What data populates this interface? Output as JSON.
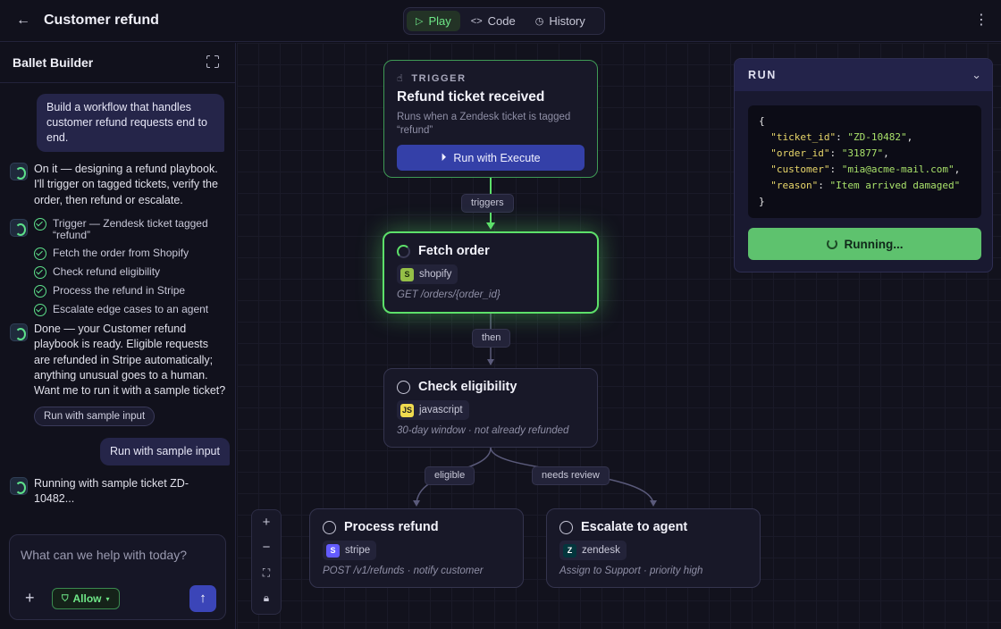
{
  "header": {
    "title": "Customer refund",
    "tabs": [
      {
        "label": "Play",
        "icon": "play-icon"
      },
      {
        "label": "Code",
        "icon": "code-icon"
      },
      {
        "label": "History",
        "icon": "history-icon"
      }
    ],
    "active_tab": "Play"
  },
  "sidebar": {
    "title": "Ballet Builder",
    "messages": {
      "user_1": "Build a workflow that handles customer refund requests end to end.",
      "assistant_1": "On it — designing a refund playbook. I'll trigger on tagged tickets, verify the order, then refund or escalate.",
      "steps": [
        "Trigger — Zendesk ticket tagged “refund”",
        "Fetch the order from Shopify",
        "Check refund eligibility",
        "Process the refund in Stripe",
        "Escalate edge cases to an agent"
      ],
      "assistant_2": "Done — your Customer refund playbook is ready. Eligible requests are refunded in Stripe automatically; anything unusual goes to a human. Want me to run it with a sample ticket?",
      "suggestion_chip": "Run with sample input",
      "user_2": "Run with sample input",
      "assistant_3": "Running with sample ticket ZD-10482..."
    },
    "composer": {
      "placeholder": "What can we help with today?",
      "allow_label": "Allow"
    }
  },
  "canvas": {
    "trigger": {
      "kicker": "TRIGGER",
      "title": "Refund ticket received",
      "subtitle": "Runs when a Zendesk ticket is tagged “refund”",
      "button": "Run with Execute"
    },
    "nodes": {
      "fetch": {
        "title": "Fetch order",
        "tag": "shopify",
        "detail": "GET /orders/{order_id}",
        "status": "running"
      },
      "check": {
        "title": "Check eligibility",
        "tag": "javascript",
        "tag_logo": "JS",
        "detail": "30-day window · not already refunded",
        "status": "pending"
      },
      "process": {
        "title": "Process refund",
        "tag": "stripe",
        "tag_logo": "S",
        "detail": "POST /v1/refunds · notify customer",
        "status": "pending"
      },
      "escalate": {
        "title": "Escalate to agent",
        "tag": "zendesk",
        "tag_logo": "Z",
        "detail": "Assign to Support · priority high",
        "status": "pending"
      }
    },
    "edges": {
      "triggers": "triggers",
      "then": "then",
      "eligible": "eligible",
      "needs_review": "needs review"
    },
    "colors": {
      "accent_green": "#5de06a",
      "primary_blue": "#3440a8",
      "bg": "#12121d"
    }
  },
  "run_panel": {
    "title": "RUN",
    "payload": {
      "ticket_id": "ZD-10482",
      "order_id": "31877",
      "customer": "mia@acme-mail.com",
      "reason": "Item arrived damaged"
    },
    "button": "Running..."
  }
}
